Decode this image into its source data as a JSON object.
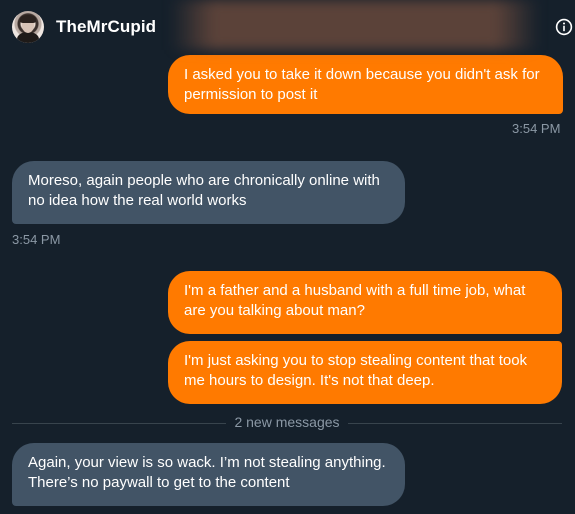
{
  "header": {
    "contact_name": "TheMrCupid",
    "info_icon": "info-icon"
  },
  "messages": [
    {
      "direction": "sent",
      "text": "I asked you to take it down because you didn't ask for permission to post it",
      "timestamp": "3:54 PM"
    },
    {
      "direction": "received",
      "text": "Moreso, again people who are chronically online with no idea how the real world works",
      "timestamp": "3:54 PM"
    },
    {
      "direction": "sent",
      "text": "I'm a father and a husband with a full time job, what are you talking about man?"
    },
    {
      "direction": "sent",
      "text": "I'm just asking you to stop stealing content that took me hours to design. It's not that deep."
    },
    {
      "direction": "received",
      "text": "Again, your view is so wack. I’m not stealing anything. There’s no paywall to get to the content"
    }
  ],
  "divider": {
    "label": "2 new messages"
  },
  "colors": {
    "background": "#15202b",
    "sent_bubble": "#ff7a00",
    "received_bubble": "#425466",
    "muted_text": "#8b98a5"
  }
}
